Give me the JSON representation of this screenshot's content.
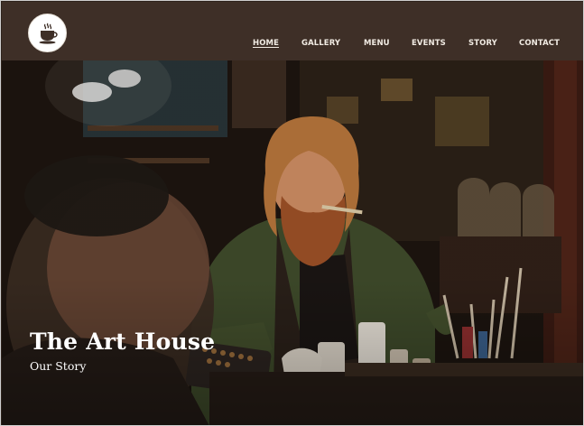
{
  "header": {
    "logo_icon": "coffee-cup-icon",
    "nav": [
      {
        "label": "HOME",
        "active": true
      },
      {
        "label": "GALLERY",
        "active": false
      },
      {
        "label": "MENU",
        "active": false
      },
      {
        "label": "EVENTS",
        "active": false
      },
      {
        "label": "STORY",
        "active": false
      },
      {
        "label": "CONTACT",
        "active": false
      }
    ]
  },
  "hero": {
    "title": "The Art House",
    "subtitle": "Our Story",
    "image_subject": "bearded-artist-painting-photo"
  },
  "colors": {
    "header_bg": "#3e2f27",
    "nav_text": "#f1ebe3",
    "hero_text": "#ffffff"
  }
}
